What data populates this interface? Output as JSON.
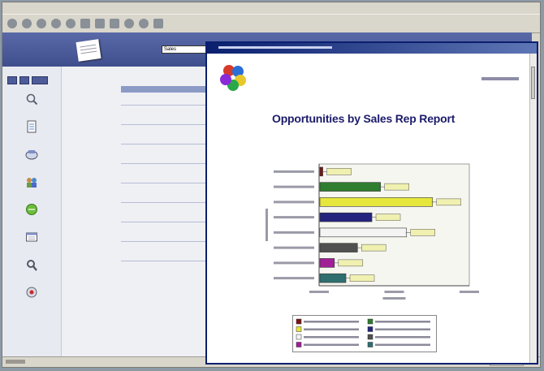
{
  "colors": {
    "header_band": "#4a5a99",
    "popup_titlebar": "#0a1f6e",
    "report_title": "#1c1c6b"
  },
  "header": {
    "app_name_line1": "",
    "app_name_line2": "",
    "reports_label": "",
    "reports_select_value": "Sales"
  },
  "sidebar": {
    "items": [
      {
        "icon": "magnifier-icon",
        "label": ""
      },
      {
        "icon": "document-icon",
        "label": ""
      },
      {
        "icon": "crm-icon",
        "label": ""
      },
      {
        "icon": "team-icon",
        "label": ""
      },
      {
        "icon": "marketing-icon",
        "label": ""
      },
      {
        "icon": "reports-icon",
        "label": ""
      },
      {
        "icon": "admin-icon",
        "label": ""
      },
      {
        "icon": "logoff-icon",
        "label": ""
      }
    ]
  },
  "report_list": {
    "items": [
      "",
      "",
      "",
      "",
      "",
      "",
      "",
      "",
      ""
    ]
  },
  "popup": {
    "window_title": "",
    "company": "",
    "datetime": "",
    "report_title": "Opportunities by Sales Rep Report"
  },
  "chart_data": {
    "type": "bar",
    "orientation": "horizontal",
    "categories": [
      "",
      "",
      "",
      "",
      "",
      "",
      "",
      ""
    ],
    "values": [
      50000,
      1050000,
      1950000,
      900000,
      1500000,
      650000,
      250000,
      450000
    ],
    "colors": [
      "#7a1515",
      "#2f7d2f",
      "#e6e63c",
      "#24247f",
      "#f4f4f4",
      "#505050",
      "#a02095",
      "#2e6e6e"
    ],
    "xlim": [
      0,
      2600000
    ],
    "x_ticks": [
      "",
      "",
      ""
    ],
    "xlabel": "",
    "ylabel": "",
    "grid": false,
    "legend_position": "bottom"
  }
}
